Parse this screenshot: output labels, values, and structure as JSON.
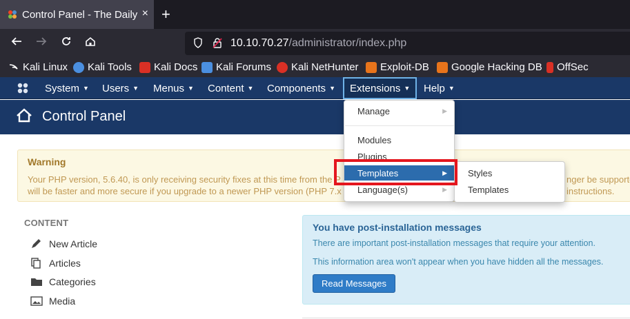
{
  "browser": {
    "tab_title": "Control Panel - The Daily",
    "tab_close": "×",
    "new_tab": "+",
    "url_host": "10.10.70.27",
    "url_path": "/administrator/index.php",
    "bookmarks": [
      {
        "label": "Kali Linux",
        "icon": "kali-linux-icon",
        "color": "#ffffff"
      },
      {
        "label": "Kali Tools",
        "icon": "kali-tools-icon",
        "color": "#4b8fe0"
      },
      {
        "label": "Kali Docs",
        "icon": "kali-docs-icon",
        "color": "#d93025"
      },
      {
        "label": "Kali Forums",
        "icon": "kali-forums-icon",
        "color": "#4b8fe0"
      },
      {
        "label": "Kali NetHunter",
        "icon": "kali-nethunter-icon",
        "color": "#d93025"
      },
      {
        "label": "Exploit-DB",
        "icon": "exploit-db-icon",
        "color": "#e8741b"
      },
      {
        "label": "Google Hacking DB",
        "icon": "google-hacking-db-icon",
        "color": "#e8741b"
      },
      {
        "label": "OffSec",
        "icon": "offsec-icon",
        "color": "#d93025"
      }
    ]
  },
  "joomla": {
    "menu": [
      {
        "label": "System"
      },
      {
        "label": "Users"
      },
      {
        "label": "Menus"
      },
      {
        "label": "Content"
      },
      {
        "label": "Components"
      },
      {
        "label": "Extensions"
      },
      {
        "label": "Help"
      }
    ],
    "page_title": "Control Panel",
    "extensions_dropdown": {
      "items": [
        "Manage",
        "Modules",
        "Plugins",
        "Templates",
        "Language(s)"
      ],
      "highlighted": "Templates"
    },
    "templates_submenu": [
      "Styles",
      "Templates"
    ],
    "warning": {
      "title": "Warning",
      "line1_left": "Your PHP version, 5.6.40, is only receiving security fixes at this time from the P",
      "line1_right": "nger be supporte",
      "line2_left": "will be faster and more secure if you upgrade to a newer PHP version (PHP 7.x",
      "line2_right": "instructions."
    },
    "sidebar": {
      "heading": "CONTENT",
      "items": [
        "New Article",
        "Articles",
        "Categories",
        "Media"
      ]
    },
    "post_install": {
      "title": "You have post-installation messages",
      "line1": "There are important post-installation messages that require your attention.",
      "line2": "This information area won't appear when you have hidden all the messages.",
      "button": "Read Messages"
    }
  },
  "colors": {
    "joomla_nav": "#1a3867",
    "highlight_blue": "#2c6cad",
    "annotation_red": "#e4161e",
    "warning_bg": "#fcf8e3",
    "info_bg": "#d9edf7"
  }
}
